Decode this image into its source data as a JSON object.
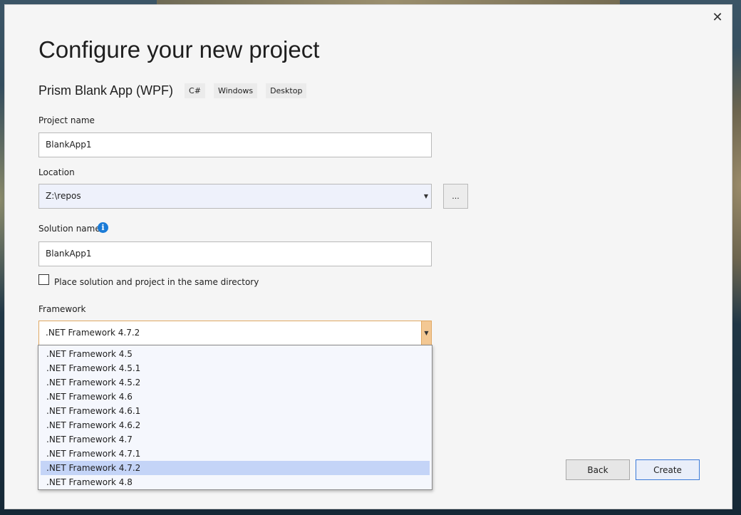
{
  "dialog": {
    "title": "Configure your new project",
    "close_glyph": "✕",
    "template": {
      "name": "Prism Blank App (WPF)",
      "tags": [
        "C#",
        "Windows",
        "Desktop"
      ]
    }
  },
  "project_name": {
    "label": "Project name",
    "value": "BlankApp1"
  },
  "location": {
    "label": "Location",
    "value": "Z:\\repos",
    "browse_label": "..."
  },
  "solution_name": {
    "label": "Solution name",
    "value": "BlankApp1",
    "info_glyph": "i"
  },
  "same_directory": {
    "label": "Place solution and project in the same directory",
    "checked": false
  },
  "framework": {
    "label": "Framework",
    "selected": ".NET Framework 4.7.2",
    "options": [
      ".NET Framework 4.5",
      ".NET Framework 4.5.1",
      ".NET Framework 4.5.2",
      ".NET Framework 4.6",
      ".NET Framework 4.6.1",
      ".NET Framework 4.6.2",
      ".NET Framework 4.7",
      ".NET Framework 4.7.1",
      ".NET Framework 4.7.2",
      ".NET Framework 4.8"
    ]
  },
  "buttons": {
    "back": "Back",
    "create": "Create"
  },
  "icons": {
    "close": "close-icon",
    "info": "info-icon",
    "dropdown": "chevron-down-icon"
  },
  "colors": {
    "accent": "#3b7ad8",
    "info": "#1a7bd7",
    "focus": "#e0a862",
    "selection": "#c4d4f7"
  }
}
